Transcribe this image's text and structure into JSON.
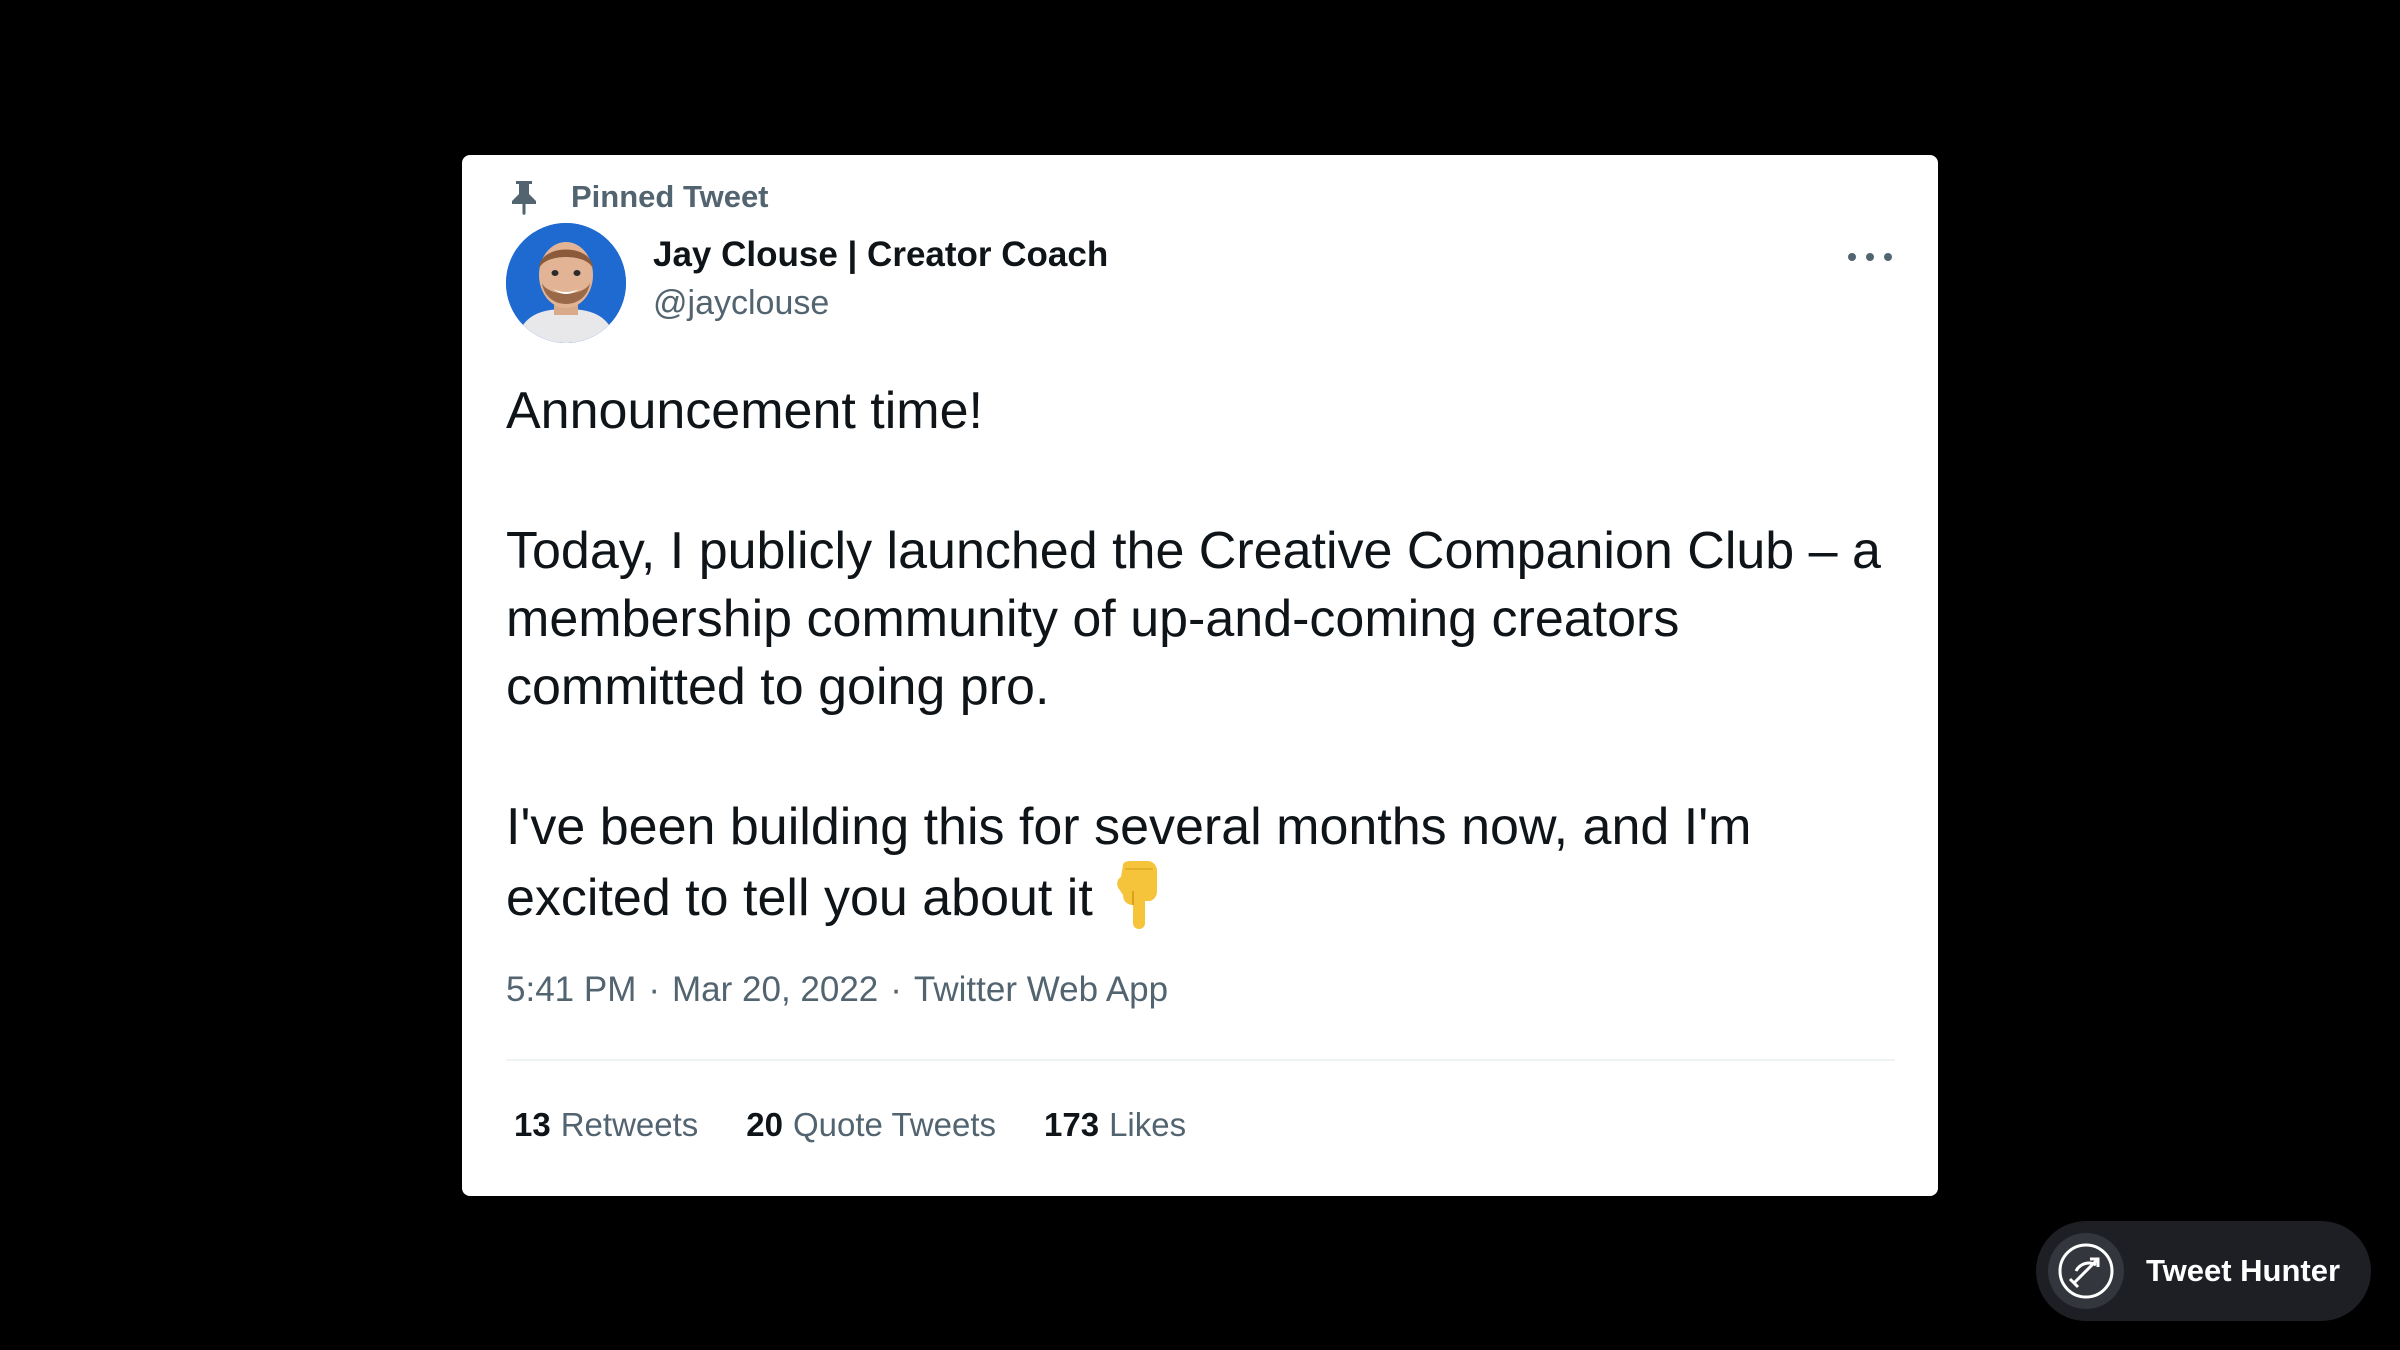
{
  "pinned": {
    "label": "Pinned Tweet",
    "icon": "pin-icon"
  },
  "author": {
    "display_name": "Jay Clouse | Creator Coach",
    "handle": "@jayclouse",
    "avatar_icon": "avatar-photo"
  },
  "tweet": {
    "paragraph_1": "Announcement time!",
    "paragraph_2": "Today, I publicly launched the Creative Companion Club – a membership community of up-and-coming creators committed to going pro.",
    "paragraph_3": "I've been building this for several months now, and I'm excited to tell you about it",
    "emoji": "👇"
  },
  "meta": {
    "time": "5:41 PM",
    "date": "Mar 20, 2022",
    "source": "Twitter Web App",
    "separator": "·"
  },
  "stats": {
    "retweets_count": "13",
    "retweets_label": "Retweets",
    "quotes_count": "20",
    "quotes_label": "Quote Tweets",
    "likes_count": "173",
    "likes_label": "Likes"
  },
  "brand": {
    "name": "Tweet Hunter",
    "icon": "tweet-hunter-logo-icon"
  },
  "colors": {
    "background": "#000000",
    "card": "#ffffff",
    "text_primary": "#0f1419",
    "text_secondary": "#536471",
    "divider": "#eff3f4",
    "brand_pill": "#1d1f24"
  }
}
